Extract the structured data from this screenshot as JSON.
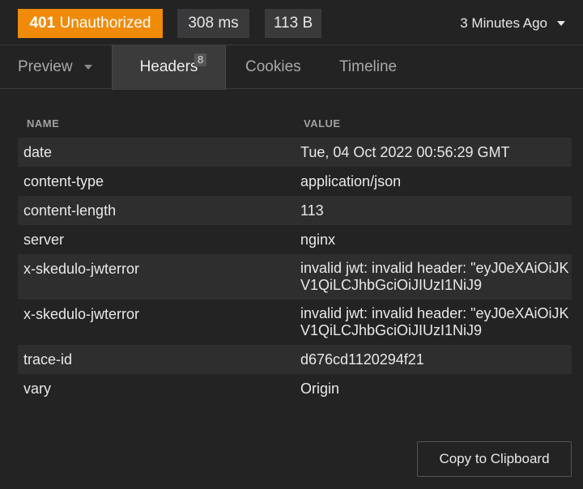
{
  "status_bar": {
    "status_code": "401",
    "status_text": "Unauthorized",
    "time": "308 ms",
    "size": "113 B",
    "timestamp": "3 Minutes Ago"
  },
  "tabs": {
    "preview": "Preview",
    "headers": "Headers",
    "headers_count": "8",
    "cookies": "Cookies",
    "timeline": "Timeline"
  },
  "table": {
    "col_name": "NAME",
    "col_value": "VALUE",
    "rows": [
      {
        "name": "date",
        "value": "Tue, 04 Oct 2022 00:56:29 GMT"
      },
      {
        "name": "content-type",
        "value": "application/json"
      },
      {
        "name": "content-length",
        "value": "113"
      },
      {
        "name": "server",
        "value": "nginx"
      },
      {
        "name": "x-skedulo-jwterror",
        "value": "invalid jwt: invalid header: \"eyJ0eXAiOiJKV1QiLCJhbGciOiJIUzI1NiJ9"
      },
      {
        "name": "x-skedulo-jwterror",
        "value": "invalid jwt: invalid header: \"eyJ0eXAiOiJKV1QiLCJhbGciOiJIUzI1NiJ9"
      },
      {
        "name": "trace-id",
        "value": "d676cd1120294f21"
      },
      {
        "name": "vary",
        "value": "Origin"
      }
    ]
  },
  "actions": {
    "copy_label": "Copy to Clipboard"
  },
  "colors": {
    "status_error": "#f08a09",
    "background": "#232323",
    "pill": "#3a3a3a"
  }
}
